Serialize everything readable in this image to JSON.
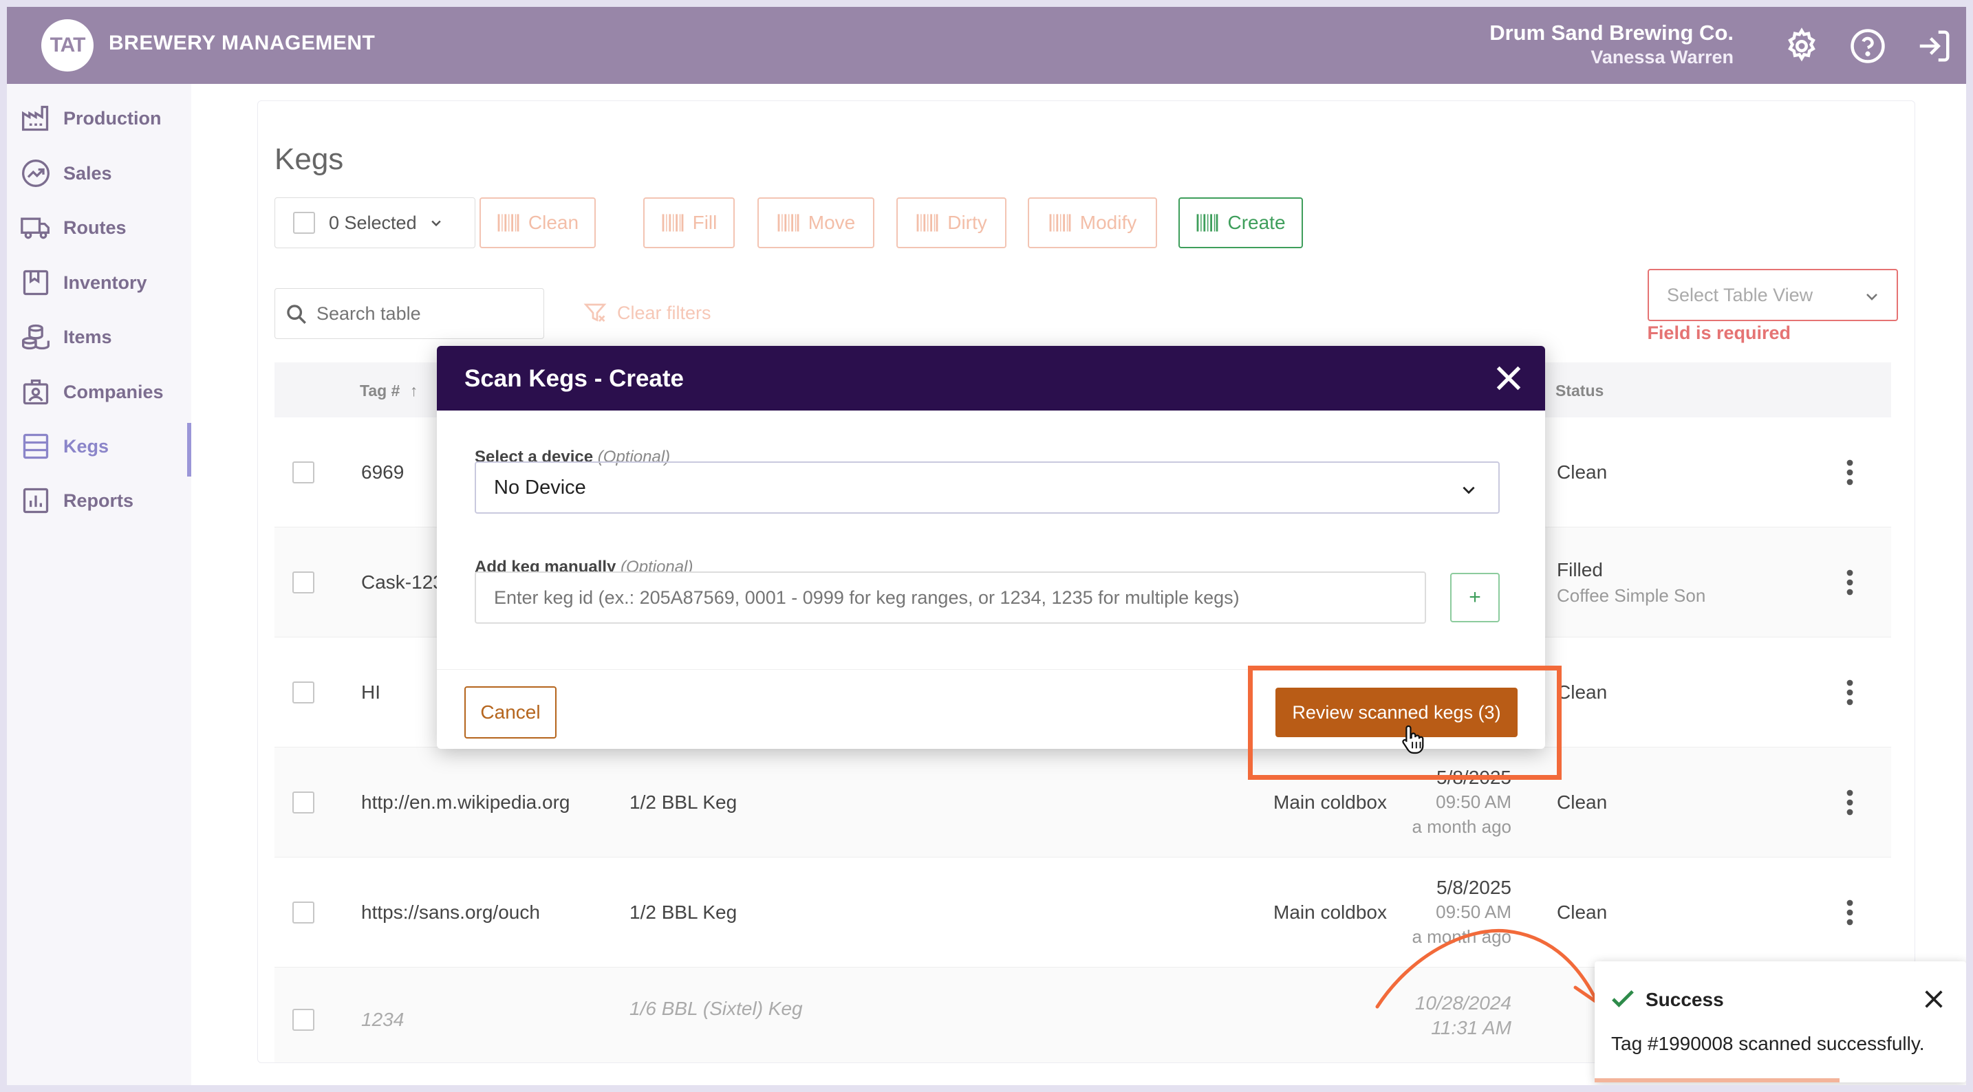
{
  "header": {
    "logo_text": "TAT",
    "app_title": "BREWERY MANAGEMENT",
    "company": "Drum Sand Brewing Co.",
    "user": "Vanessa Warren"
  },
  "sidebar": {
    "items": [
      {
        "label": "Production",
        "icon": "factory-icon"
      },
      {
        "label": "Sales",
        "icon": "trend-icon"
      },
      {
        "label": "Routes",
        "icon": "truck-icon"
      },
      {
        "label": "Inventory",
        "icon": "bookmark-icon"
      },
      {
        "label": "Items",
        "icon": "barrels-icon"
      },
      {
        "label": "Companies",
        "icon": "badge-icon"
      },
      {
        "label": "Kegs",
        "icon": "keg-icon",
        "active": true
      },
      {
        "label": "Reports",
        "icon": "chart-icon"
      }
    ]
  },
  "page": {
    "title": "Kegs",
    "selected_label": "0 Selected",
    "actions": [
      "Clean",
      "Fill",
      "Move",
      "Dirty",
      "Modify",
      "Create"
    ],
    "search_placeholder": "Search table",
    "clear_filters": "Clear filters",
    "table_view_placeholder": "Select Table View",
    "field_required": "Field is required"
  },
  "table": {
    "headers": {
      "tag": "Tag #",
      "status": "Status"
    },
    "rows": [
      {
        "tag": "6969",
        "type": "",
        "date": "",
        "time": "",
        "ago": "",
        "location": "",
        "status": "Clean",
        "status_sub": ""
      },
      {
        "tag": "Cask-123",
        "type": "",
        "date": "",
        "time": "",
        "ago": "",
        "location": "",
        "status": "Filled",
        "status_sub": "Coffee Simple Son"
      },
      {
        "tag": "HI",
        "type": "",
        "date": "",
        "time": "",
        "ago": "",
        "location": "",
        "status": "Clean",
        "status_sub": ""
      },
      {
        "tag": "http://en.m.wikipedia.org",
        "type": "1/2 BBL Keg",
        "date": "5/8/2025",
        "time": "09:50 AM",
        "ago": "a month ago",
        "location": "Main coldbox",
        "status": "Clean",
        "status_sub": ""
      },
      {
        "tag": "https://sans.org/ouch",
        "type": "1/2 BBL Keg",
        "date": "5/8/2025",
        "time": "09:50 AM",
        "ago": "a month ago",
        "location": "Main coldbox",
        "status": "Clean",
        "status_sub": ""
      },
      {
        "tag": "1234",
        "type": "1/6 BBL (Sixtel) Keg",
        "date": "10/28/2024",
        "time": "11:31 AM",
        "ago": "",
        "location": "",
        "status": "",
        "status_sub": ""
      }
    ]
  },
  "modal": {
    "title": "Scan Kegs - Create",
    "device_label": "Select a device",
    "device_optional": "(Optional)",
    "device_value": "No Device",
    "manual_label": "Add keg manually",
    "manual_optional": "(Optional)",
    "manual_placeholder": "Enter keg id (ex.: 205A87569, 0001 - 0999 for keg ranges, or 1234, 1235 for multiple kegs)",
    "add_symbol": "+",
    "cancel": "Cancel",
    "review": "Review scanned kegs (3)"
  },
  "toast": {
    "title": "Success",
    "message": "Tag #1990008 scanned successfully.",
    "progress": 0.66
  },
  "colors": {
    "header": "#9886a8",
    "modal_header": "#2b0f4d",
    "primary_button": "#b95c16",
    "highlight": "#f26a3a",
    "success": "#3e9e5b"
  }
}
